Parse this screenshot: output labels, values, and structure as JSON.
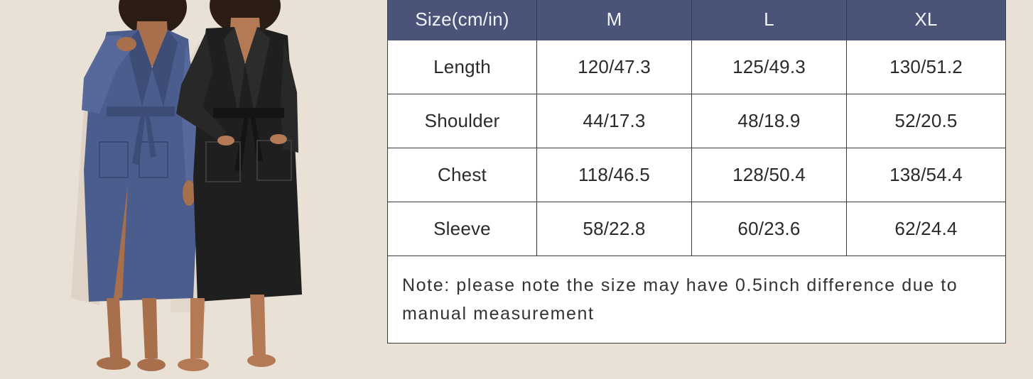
{
  "colors": {
    "background": "#e9e0d6",
    "header": "#4a5478",
    "blue_robe": "#4b5d8c",
    "black_robe": "#1f1f1f"
  },
  "image": {
    "subject": "two-models-wearing-long-velvet-robes"
  },
  "table": {
    "headers": [
      "Size(cm/in)",
      "M",
      "L",
      "XL"
    ],
    "rows": [
      [
        "Length",
        "120/47.3",
        "125/49.3",
        "130/51.2"
      ],
      [
        "Shoulder",
        "44/17.3",
        "48/18.9",
        "52/20.5"
      ],
      [
        "Chest",
        "118/46.5",
        "128/50.4",
        "138/54.4"
      ],
      [
        "Sleeve",
        "58/22.8",
        "60/23.6",
        "62/24.4"
      ]
    ],
    "note": "Note: please note the size may have 0.5inch difference due to manual measurement"
  }
}
